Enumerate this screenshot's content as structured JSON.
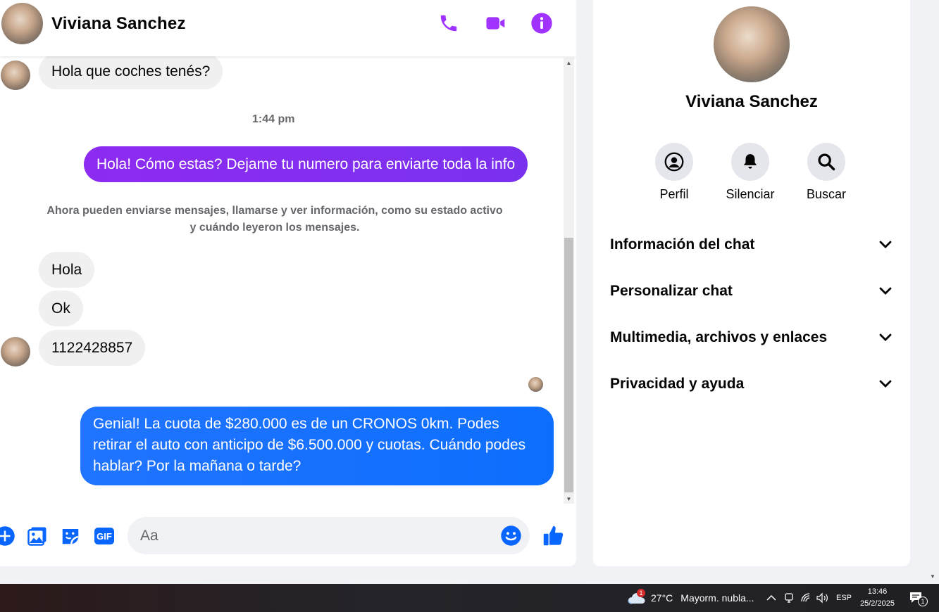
{
  "header": {
    "name": "Viviana Sanchez"
  },
  "messages": {
    "m1": "Hola que coches tenés?",
    "time1": "1:44 pm",
    "m2": "Hola! Cómo estas? Dejame tu numero para enviarte toda la info",
    "note": "Ahora pueden enviarse mensajes, llamarse y ver información, como su estado activo y cuándo leyeron los mensajes.",
    "m3": "Hola",
    "m4": "Ok",
    "m5": "1122428857",
    "m6": "Genial! La cuota de $280.000 es de un CRONOS 0km. Podes retirar el auto con anticipo de $6.500.000 y cuotas. Cuándo podes hablar? Por la mañana o tarde?"
  },
  "composer": {
    "placeholder": "Aa",
    "gif_label": "GIF"
  },
  "info": {
    "name": "Viviana Sanchez",
    "actions": {
      "profile": "Perfil",
      "mute": "Silenciar",
      "search": "Buscar"
    },
    "sections": {
      "chat_info": "Información del chat",
      "customize": "Personalizar chat",
      "media": "Multimedia, archivos y enlaces",
      "privacy": "Privacidad y ayuda"
    }
  },
  "taskbar": {
    "weather_badge": "1",
    "temperature": "27°C",
    "weather": "Mayorm. nubla...",
    "language": "ESP",
    "time": "13:46",
    "date": "25/2/2025",
    "notif_count": "1"
  },
  "colors": {
    "accent_purple": "#a033ff",
    "messenger_blue": "#0866ff",
    "bubble_purple": "#8a2be2"
  }
}
